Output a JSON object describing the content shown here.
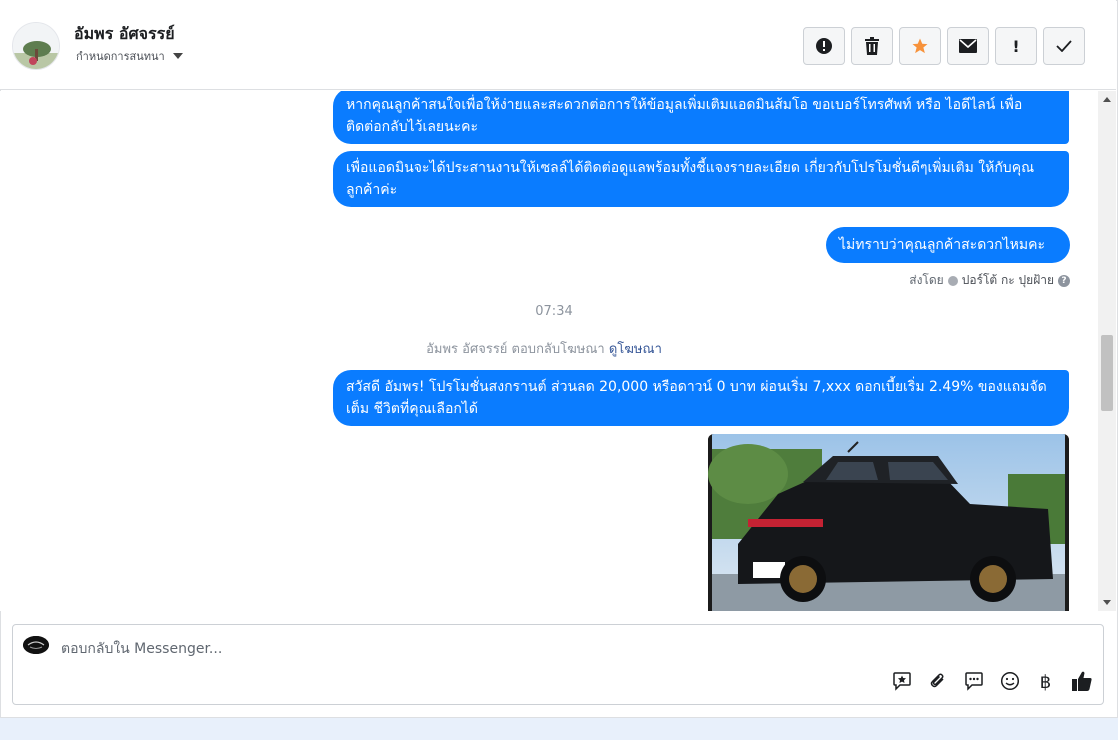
{
  "header": {
    "contact_name": "อัมพร อัศจรรย์",
    "assign_label": "กำหนดการสนทนา"
  },
  "toolbar": {
    "buttons": [
      {
        "icon": "alert-circle-icon"
      },
      {
        "icon": "trash-icon"
      },
      {
        "icon": "star-icon",
        "color": "#f7923b"
      },
      {
        "icon": "envelope-icon"
      },
      {
        "icon": "exclamation-icon",
        "label": "!"
      },
      {
        "icon": "check-icon"
      }
    ]
  },
  "messages": {
    "msg1": "หากคุณลูกค้าสนใจเพื่อให้ง่ายและสะดวกต่อการให้ข้อมูลเพิ่มเติมแอดมินส้มโอ ขอเบอร์โทรศัพท์ หรือ ไอดีไลน์ เพื่อติดต่อกลับไว้เลยนะคะ",
    "msg2": "เพื่อแอดมินจะได้ประสานงานให้เซลล์ได้ติดต่อดูแลพร้อมทั้งชี้แจงรายละเอียด เกี่ยวกับโปรโมชั่นดีๆเพิ่มเติม ให้กับคุณลูกค้าค่ะ",
    "msg3": "ไม่ทราบว่าคุณลูกค้าสะดวกไหมคะ",
    "sent_by_prefix": "ส่งโดย",
    "sent_by_name": "ปอร์โต้ กะ ปุยฝ้าย",
    "time": "07:34",
    "ad_reply_text": "อัมพร อัศจรรย์ ตอบกลับโฆษณา",
    "ad_reply_link": "ดูโฆษณา",
    "msg4": "สวัสดี อัมพร! โปรโมชั่นสงกรานต์ ส่วนลด 20,000 หรือดาวน์ 0 บาท ผ่อนเริ่ม 7,xxx ดอกเบี้ยเริ่ม 2.49% ของแถมจัดเต็ม ชีวิตที่คุณเลือกได้"
  },
  "composer": {
    "placeholder": "ตอบกลับใน Messenger...",
    "baht_symbol": "฿"
  },
  "colors": {
    "bubble": "#0a7cff",
    "accent_star": "#f7923b"
  }
}
